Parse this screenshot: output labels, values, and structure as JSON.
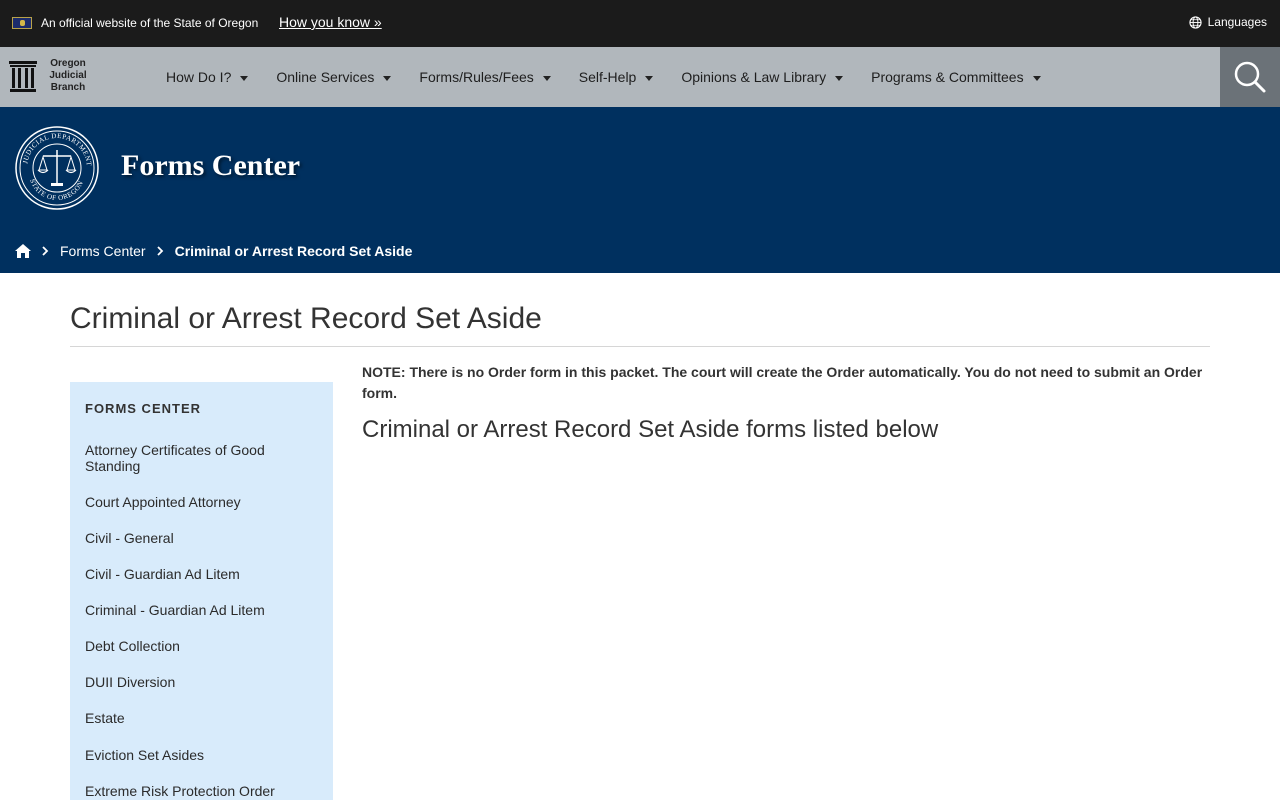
{
  "gov_banner": {
    "official_text": "An official website of the State of Oregon",
    "how_you_know": "How you know »",
    "languages": "Languages"
  },
  "navbar": {
    "logo_lines": [
      "Oregon",
      "Judicial",
      "Branch"
    ],
    "items": [
      {
        "label": "How Do I?"
      },
      {
        "label": "Online Services"
      },
      {
        "label": "Forms/Rules/Fees"
      },
      {
        "label": "Self-Help"
      },
      {
        "label": "Opinions & Law Library"
      },
      {
        "label": "Programs & Committees"
      }
    ],
    "search_icon": "search-icon"
  },
  "hero": {
    "title": "Forms Center",
    "breadcrumb": {
      "home_icon": "home-icon",
      "items": [
        "Forms Center"
      ],
      "current": "Criminal or Arrest Record Set Aside"
    }
  },
  "main": {
    "page_title": "Criminal or Arrest Record Set Aside",
    "note": "NOTE: There is no Order form in this packet. The court will create the Order automatically. You do not need to submit an Order form.",
    "sub_heading": "Criminal or Arrest Record Set Aside forms listed below"
  },
  "sidebar": {
    "heading": "FORMS CENTER",
    "items": [
      "Attorney Certificates of Good Standing",
      "Court Appointed Attorney",
      "Civil - General",
      "Civil - Guardian Ad Litem",
      "Criminal - Guardian Ad Litem",
      "Debt Collection",
      "DUII Diversion",
      "Estate",
      "Eviction Set Asides",
      "Extreme Risk Protection Order"
    ]
  },
  "colors": {
    "banner_bg": "#1b1b1b",
    "nav_bg": "#b1b7bc",
    "search_bg": "#6b7278",
    "hero_bg": "#00305f",
    "sidebar_bg": "#d8ebfb"
  }
}
